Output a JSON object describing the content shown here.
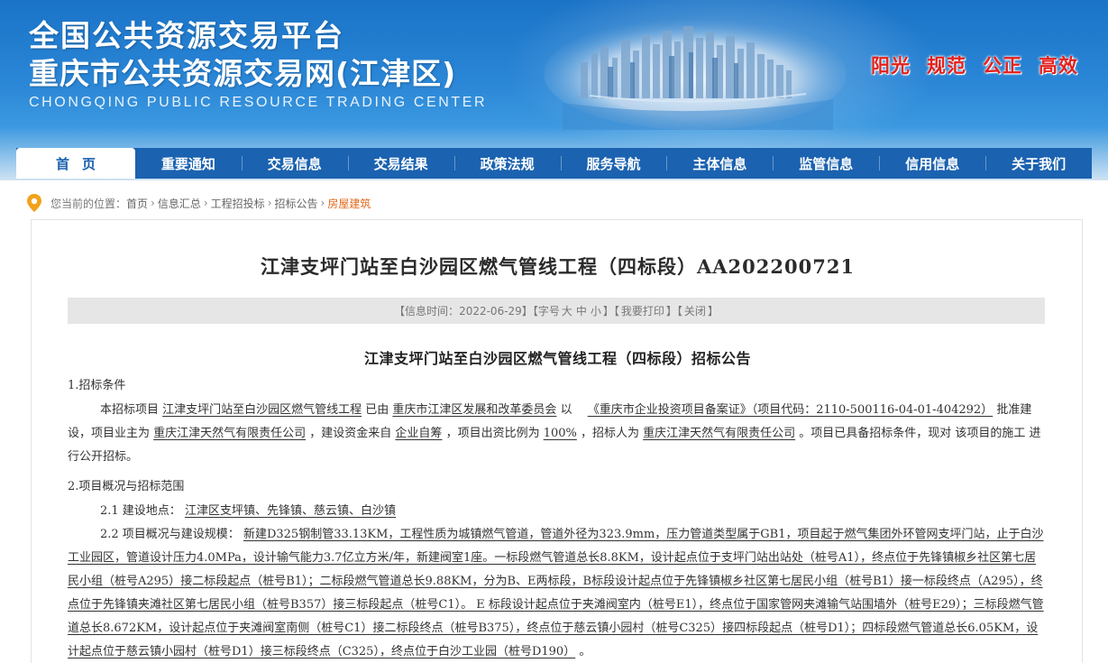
{
  "header": {
    "title_line1": "全国公共资源交易平台",
    "title_line2": "重庆市公共资源交易网(江津区)",
    "title_en": "CHONGQING PUBLIC RESOURCE TRADING CENTER",
    "slogans": [
      "阳光",
      "规范",
      "公正",
      "高效"
    ]
  },
  "nav": {
    "items": [
      "首页",
      "重要通知",
      "交易信息",
      "交易结果",
      "政策法规",
      "服务导航",
      "主体信息",
      "监管信息",
      "信用信息",
      "关于我们"
    ]
  },
  "breadcrumb": {
    "label": "您当前的位置：",
    "items": [
      "首页",
      "信息汇总",
      "工程招投标",
      "招标公告",
      "房屋建筑"
    ],
    "separator": "›"
  },
  "article": {
    "title": "江津支坪门站至白沙园区燃气管线工程（四标段）AA202200721",
    "info": {
      "prefix": "【信息时间：",
      "date": "2022-06-29",
      "after_date": "】【字号",
      "size_large": "大",
      "size_mid": "中",
      "size_small": "小",
      "after_size": "】【",
      "print": "我要打印",
      "mid": "】【",
      "close": "关闭",
      "suffix": "】"
    },
    "notice_title": "江津支坪门站至白沙园区燃气管线工程（四标段）招标公告",
    "sec1_title": "1.招标条件",
    "sec1": {
      "t1": "本招标项目 ",
      "u1": "江津支坪门站至白沙园区燃气管线工程",
      "t2": " 已由 ",
      "u2": "重庆市江津区发展和改革委员会",
      "t3": " 以　 ",
      "u3": "《重庆市企业投资项目备案证》（项目代码：2110-500116-04-01-404292）",
      "t4": " 批准建设，项目业主为 ",
      "u4": "重庆江津天然气有限责任公司",
      "t5": " ，建设资金来自 ",
      "u5": "企业自筹",
      "t6": " ，项目出资比例为 ",
      "u6": "100%",
      "t7": " ，招标人为 ",
      "u7": "重庆江津天然气有限责任公司",
      "t8": " 。项目已具备招标条件，现对 该项目的施工 进行公开招标。"
    },
    "sec2_title": "2.项目概况与招标范围",
    "sec2_1": {
      "label": "2.1 建设地点：",
      "value": "江津区支坪镇、先锋镇、慈云镇、白沙镇"
    },
    "sec2_2": {
      "label": "2.2 项目概况与建设规模：",
      "value": "新建D325钢制管33.13KM，工程性质为城镇燃气管道，管道外径为323.9mm，压力管道类型属于GB1，项目起于燃气集团外环管网支坪门站，止于白沙工业园区，管道设计压力4.0MPa，设计输气能力3.7亿立方米/年，新建阀室1座。一标段燃气管道总长8.8KM，设计起点位于支坪门站出站处（桩号A1），终点位于先锋镇椒乡社区第七居民小组（桩号A295）接二标段起点（桩号B1）；二标段燃气管道总长9.88KM，分为B、E两标段，B标段设计起点位于先锋镇椒乡社区第七居民小组（桩号B1）接一标段终点（A295），终点位于先锋镇夹滩社区第七居民小组（桩号B357）接三标段起点（桩号C1）。 E 标段设计起点位于夹滩阀室内（桩号E1），终点位于国家管网夹滩输气站围墙外（桩号E29）；三标段燃气管道总长8.672KM，设计起点位于夹滩阀室南侧（桩号C1）接二标段终点（桩号B375），终点位于慈云镇小园村（桩号C325）接四标段起点（桩号D1）；四标段燃气管道总长6.05KM，设计起点位于慈云镇小园村（桩号D1）接三标段终点（C325），终点位于白沙工业园（桩号D190）",
      "end": " 。"
    }
  },
  "colors": {
    "banner": "#1f7bcc",
    "nav": "#1b62b0",
    "slogan": "#e4201c",
    "crumb_current": "#e3691b",
    "info_bar": "#e6e6e6"
  }
}
